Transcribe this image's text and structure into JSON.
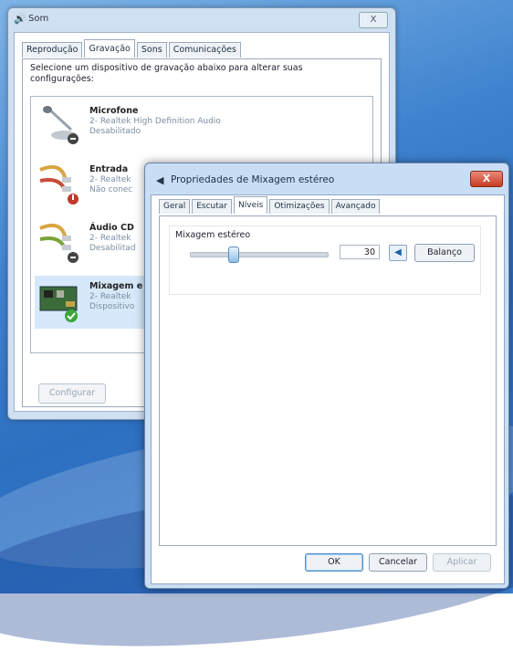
{
  "sound_window": {
    "title": "Som",
    "close_label": "X",
    "tabs": [
      {
        "label": "Reprodução",
        "active": false
      },
      {
        "label": "Gravação",
        "active": true
      },
      {
        "label": "Sons",
        "active": false
      },
      {
        "label": "Comunicações",
        "active": false
      }
    ],
    "instruction": "Selecione um dispositivo de gravação abaixo para alterar suas configurações:",
    "devices": [
      {
        "name": "Microfone",
        "sub": "2- Realtek High Definition Audio",
        "state": "Desabilitado",
        "icon": "microphone-icon"
      },
      {
        "name": "Entrada",
        "sub": "2- Realtek",
        "state": "Não conec",
        "icon": "line-in-icon"
      },
      {
        "name": "Áudio CD",
        "sub": "2- Realtek",
        "state": "Desabilitad",
        "icon": "cd-audio-icon"
      },
      {
        "name": "Mixagem e",
        "sub": "2- Realtek",
        "state": "Dispositivo",
        "icon": "stereo-mix-icon"
      }
    ],
    "configure_label": "Configurar"
  },
  "properties_dialog": {
    "title": "Propriedades de Mixagem estéreo",
    "close_label": "X",
    "tabs": [
      {
        "label": "Geral",
        "active": false
      },
      {
        "label": "Escutar",
        "active": false
      },
      {
        "label": "Níveis",
        "active": true
      },
      {
        "label": "Otimizações",
        "active": false
      },
      {
        "label": "Avançado",
        "active": false
      }
    ],
    "level_label": "Mixagem estéreo",
    "level_value": "30",
    "level_fraction": 0.3,
    "speaker_icon": "speaker-icon",
    "balance_label": "Balanço",
    "ok_label": "OK",
    "cancel_label": "Cancelar",
    "apply_label": "Aplicar"
  },
  "colors": {
    "accent": "#4f8ed0",
    "selection": "#d6e8fa",
    "close_red": "#c73b22"
  }
}
